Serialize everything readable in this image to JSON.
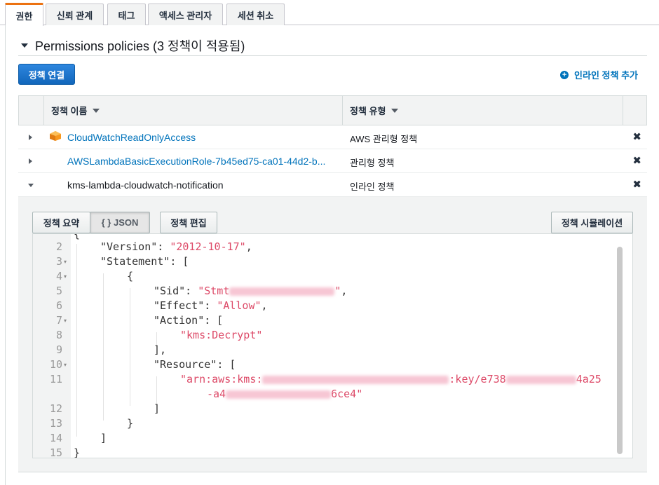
{
  "tabs": [
    {
      "label": "권한",
      "active": true
    },
    {
      "label": "신뢰 관계"
    },
    {
      "label": "태그"
    },
    {
      "label": "액세스 관리자"
    },
    {
      "label": "세션 취소"
    }
  ],
  "section": {
    "title": "Permissions policies (3 정책이 적용됨)"
  },
  "actions": {
    "attach": "정책 연결",
    "inline_add": "인라인 정책 추가"
  },
  "table": {
    "columns": [
      "정책 이름",
      "정책 유형"
    ],
    "rows": [
      {
        "name": "CloudWatchReadOnlyAccess",
        "type": "AWS 관리형 정책",
        "link": true,
        "aws_managed": true,
        "expanded": false
      },
      {
        "name": "AWSLambdaBasicExecutionRole-7b45ed75-ca01-44d2-b...",
        "type": "관리형 정책",
        "link": true,
        "aws_managed": false,
        "expanded": false
      },
      {
        "name": "kms-lambda-cloudwatch-notification",
        "type": "인라인 정책",
        "link": false,
        "aws_managed": false,
        "expanded": true
      }
    ],
    "remove_glyph": "✖"
  },
  "detail": {
    "summary_btn": "정책 요약",
    "json_btn": "{ } JSON",
    "edit_btn": "정책 편집",
    "simulate_btn": "정책 시뮬레이션"
  },
  "code": {
    "line_numbers": [
      "2",
      "3",
      "4",
      "5",
      "6",
      "7",
      "8",
      "9",
      "10",
      "11",
      "",
      "12",
      "13",
      "14",
      "15"
    ],
    "version_key": "\"Version\"",
    "version_val": "\"2012-10-17\"",
    "statement_key": "\"Statement\"",
    "sid_key": "\"Sid\"",
    "sid_val": "\"Stmt",
    "effect_key": "\"Effect\"",
    "effect_val": "\"Allow\"",
    "action_key": "\"Action\"",
    "action_val": "\"kms:Decrypt\"",
    "resource_key": "\"Resource\"",
    "resource_a": "\"arn:aws:kms:",
    "resource_b": ":key/e738",
    "resource_c": "4a25",
    "resource_d": "-a4",
    "resource_e": "6ce4\""
  },
  "colors": {
    "accent_tab": "#ec7211",
    "primary_btn": "#1166bb",
    "link": "#0073bb",
    "json_string": "#dd4a68"
  }
}
